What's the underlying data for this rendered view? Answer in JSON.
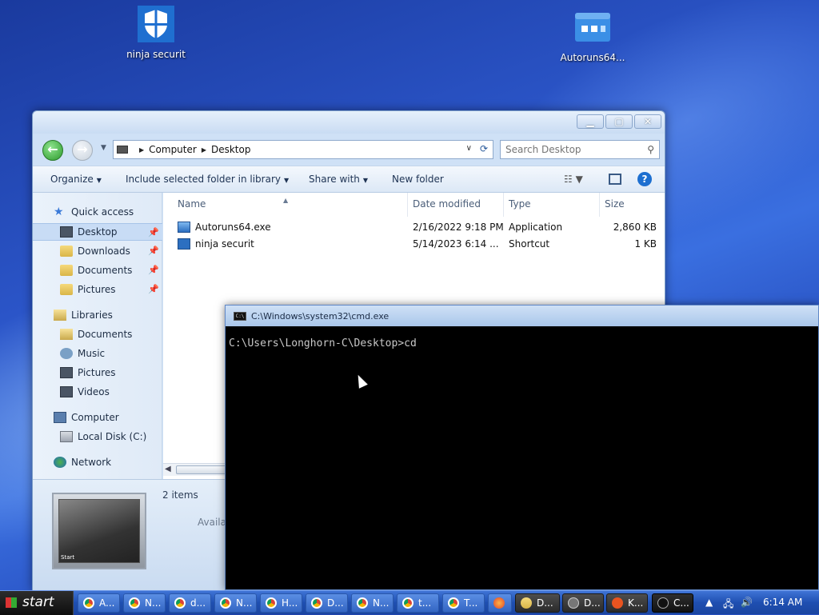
{
  "desktop": {
    "icons": [
      {
        "label": "ninja securit",
        "icon": "shield-icon"
      },
      {
        "label": "Autoruns64...",
        "icon": "autoruns-icon"
      }
    ]
  },
  "explorer": {
    "address": {
      "crumbs": [
        "Computer",
        "Desktop"
      ]
    },
    "search": {
      "placeholder": "Search Desktop"
    },
    "toolbar": {
      "organize": "Organize",
      "include": "Include selected folder in library",
      "share": "Share with",
      "new_folder": "New folder"
    },
    "nav": {
      "quick_access": "Quick access",
      "desktop": "Desktop",
      "downloads": "Downloads",
      "documents": "Documents",
      "pictures": "Pictures",
      "libraries": "Libraries",
      "lib_documents": "Documents",
      "lib_music": "Music",
      "lib_pictures": "Pictures",
      "lib_videos": "Videos",
      "computer": "Computer",
      "local_disk": "Local Disk (C:)",
      "network": "Network"
    },
    "columns": {
      "name": "Name",
      "date": "Date modified",
      "type": "Type",
      "size": "Size"
    },
    "files": [
      {
        "name": "Autoruns64.exe",
        "date": "2/16/2022 9:18 PM",
        "type": "Application",
        "size": "2,860 KB"
      },
      {
        "name": "ninja securit",
        "date": "5/14/2023 6:14 ...",
        "type": "Shortcut",
        "size": "1 KB"
      }
    ],
    "details": {
      "items": "2 items",
      "avail": "Availa",
      "thumb_label": "Start"
    }
  },
  "cmd": {
    "title": "C:\\Windows\\system32\\cmd.exe",
    "icon_label": "C:\\",
    "prompt": "C:\\Users\\Longhorn-C\\Desktop>cd"
  },
  "taskbar": {
    "start": "start",
    "tasks": [
      {
        "label": "A...",
        "icon": "chrome"
      },
      {
        "label": "N...",
        "icon": "chrome"
      },
      {
        "label": "d...",
        "icon": "chrome"
      },
      {
        "label": "N...",
        "icon": "chrome"
      },
      {
        "label": "H...",
        "icon": "chrome"
      },
      {
        "label": "D...",
        "icon": "chrome"
      },
      {
        "label": "N...",
        "icon": "chrome"
      },
      {
        "label": "t...",
        "icon": "chrome"
      },
      {
        "label": "T...",
        "icon": "chrome"
      },
      {
        "label": "",
        "icon": "firefox"
      },
      {
        "label": "D...",
        "icon": "folder"
      },
      {
        "label": "D...",
        "icon": "display"
      },
      {
        "label": "K...",
        "icon": "ubuntu"
      },
      {
        "label": "C...",
        "icon": "cmd"
      }
    ],
    "clock": "6:14 AM"
  }
}
